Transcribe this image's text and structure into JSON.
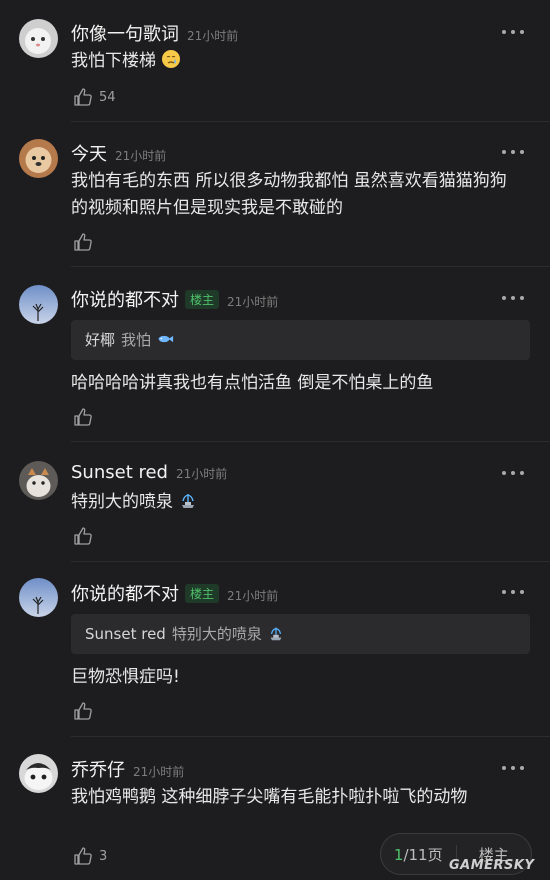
{
  "comments": [
    {
      "name": "你像一句歌词",
      "time": "21小时前",
      "text": "我怕下楼梯",
      "likes": "54"
    },
    {
      "name": "今天",
      "time": "21小时前",
      "text": "我怕有毛的东西 所以很多动物我都怕 虽然喜欢看猫猫狗狗的视频和照片但是现实我是不敢碰的",
      "likes": ""
    },
    {
      "name": "你说的都不对",
      "badge": "楼主",
      "time": "21小时前",
      "quote_name": "好椰",
      "quote_text": "我怕",
      "text": "哈哈哈哈讲真我也有点怕活鱼 倒是不怕桌上的鱼",
      "likes": ""
    },
    {
      "name": "Sunset red",
      "time": "21小时前",
      "text": "特别大的喷泉",
      "likes": ""
    },
    {
      "name": "你说的都不对",
      "badge": "楼主",
      "time": "21小时前",
      "quote_name": "Sunset red",
      "quote_text": "特别大的喷泉",
      "text": "巨物恐惧症吗!",
      "likes": ""
    },
    {
      "name": "乔乔仔",
      "time": "21小时前",
      "text": "我怕鸡鸭鹅 这种细脖子尖嘴有毛能扑啦扑啦飞的动物",
      "likes": "3"
    }
  ],
  "pager": {
    "current": "1",
    "total": "/11页",
    "op_label": "楼主"
  },
  "watermark": "GAMERSKY",
  "icons": {
    "more": "more-dots-icon",
    "like": "thumbs-up-icon"
  },
  "colors": {
    "background": "#1d1d1f",
    "badge": "#4fbf6a",
    "time": "#7d7d7d"
  }
}
